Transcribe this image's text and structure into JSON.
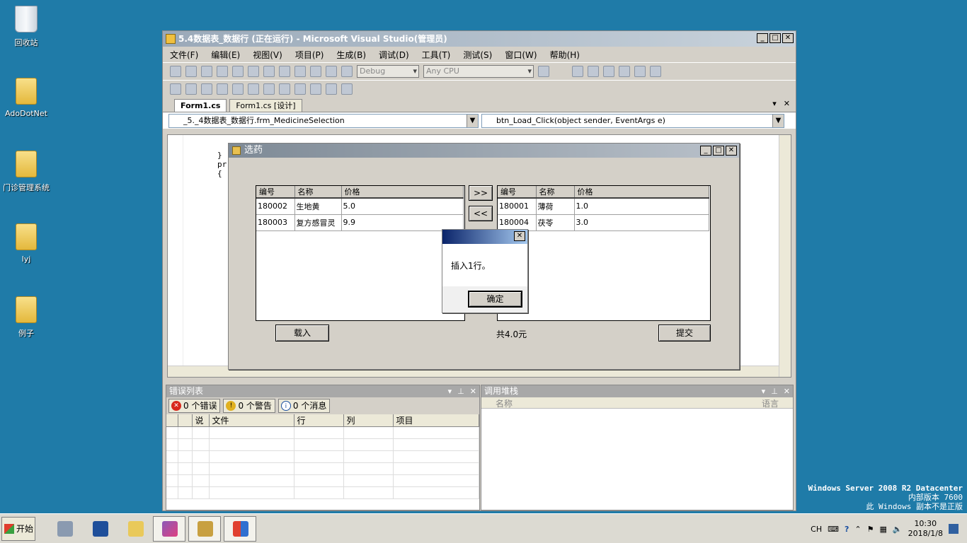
{
  "desktop": {
    "icons": [
      {
        "label": "回收站"
      },
      {
        "label": "AdoDotNet"
      },
      {
        "label": "门诊管理系统"
      },
      {
        "label": "lyj"
      },
      {
        "label": "例子"
      }
    ],
    "watermark": {
      "line1": "Windows Server 2008 R2 Datacenter",
      "line2": "内部版本 7600",
      "line3": "此 Windows 副本不是正版"
    }
  },
  "vs": {
    "title": "5.4数据表_数据行 (正在运行) - Microsoft Visual Studio(管理员)",
    "menu": [
      "文件(F)",
      "编辑(E)",
      "视图(V)",
      "项目(P)",
      "生成(B)",
      "调试(D)",
      "工具(T)",
      "测试(S)",
      "窗口(W)",
      "帮助(H)"
    ],
    "config": "Debug",
    "platform": "Any CPU",
    "tabs": [
      "Form1.cs",
      "Form1.cs [设计]"
    ],
    "nav_class": "_5._4数据表_数据行.frm_MedicineSelection",
    "nav_member": "btn_Load_Click(object sender, EventArgs e)",
    "code_lines": [
      "}",
      "",
      "pr",
      "{"
    ]
  },
  "form": {
    "title": "选药",
    "left_grid": {
      "headers": [
        "编号",
        "名称",
        "价格"
      ],
      "rows": [
        [
          "180002",
          "生地黄",
          "5.0"
        ],
        [
          "180003",
          "复方感冒灵",
          "9.9"
        ]
      ]
    },
    "right_grid": {
      "headers": [
        "编号",
        "名称",
        "价格"
      ],
      "rows": [
        [
          "180001",
          "薄荷",
          "1.0"
        ],
        [
          "180004",
          "茯苓",
          "3.0"
        ]
      ]
    },
    "add_btn": ">>",
    "remove_btn": "<<",
    "load_btn": "载入",
    "total": "共4.0元",
    "submit_btn": "提交"
  },
  "msgbox": {
    "close": "✕",
    "text": "插入1行。",
    "ok": "确定"
  },
  "errors": {
    "title": "错误列表",
    "errors_btn": "0 个错误",
    "warnings_btn": "0 个警告",
    "messages_btn": "0 个消息",
    "headers": [
      "",
      "",
      "说",
      "文件",
      "行",
      "列",
      "项目"
    ]
  },
  "callstack": {
    "title": "调用堆栈",
    "headers": [
      "名称",
      "语言"
    ]
  },
  "taskbar": {
    "start": "开始",
    "lang": "CH",
    "time": "10:30",
    "date": "2018/1/8"
  }
}
